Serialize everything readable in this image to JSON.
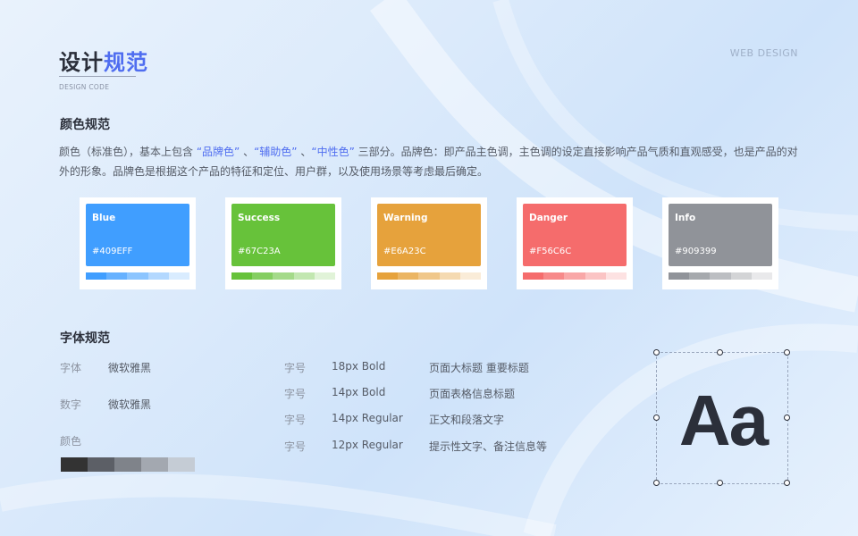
{
  "header": {
    "title_part1": "设计",
    "title_part2": "规范",
    "subtitle": "DESIGN CODE",
    "corner_label": "WEB DESIGN"
  },
  "color_section": {
    "title": "颜色规范",
    "desc_1": "颜色（标准色），基本上包含 ",
    "hl_1": "“品牌色”",
    "sep_1": " 、",
    "hl_2": "“辅助色”",
    "sep_2": " 、",
    "hl_3": "“中性色”",
    "desc_2": " 三部分。品牌色：即产品主色调，主色调的设定直接影响产品气质和直观感受，也是产品的对外的形象。品牌色是根据这个产品的特征和定位、用户群，以及使用场景等考虑最后确定。",
    "cards": [
      {
        "name": "Blue",
        "hex": "#409EFF",
        "color": "#409EFF",
        "tints": [
          "#409EFF",
          "#66b1ff",
          "#8cc5ff",
          "#b3d8ff",
          "#d9ecff"
        ]
      },
      {
        "name": "Success",
        "hex": "#67C23A",
        "color": "#67C23A",
        "tints": [
          "#67C23A",
          "#85ce61",
          "#a4da89",
          "#c2e7b0",
          "#e1f3d8"
        ]
      },
      {
        "name": "Warning",
        "hex": "#E6A23C",
        "color": "#E6A23C",
        "tints": [
          "#E6A23C",
          "#ebb563",
          "#f0c78a",
          "#f5dab1",
          "#faecd8"
        ]
      },
      {
        "name": "Danger",
        "hex": "#F56C6C",
        "color": "#F56C6C",
        "tints": [
          "#F56C6C",
          "#f78989",
          "#f9a7a7",
          "#fbc4c4",
          "#fde2e2"
        ]
      },
      {
        "name": "Info",
        "hex": "#909399",
        "color": "#909399",
        "tints": [
          "#909399",
          "#a6a9ad",
          "#bcbec2",
          "#d3d4d6",
          "#e9e9eb"
        ]
      }
    ]
  },
  "font_section": {
    "title": "字体规范",
    "font_label": "字体",
    "font_value": "微软雅黑",
    "number_label": "数字",
    "number_value": "微软雅黑",
    "color_label": "颜色",
    "gray_scale": [
      "#333333",
      "#5c5f66",
      "#7f838a",
      "#a3a8b0",
      "#c5ccd5"
    ],
    "sizes": [
      {
        "label": "字号",
        "size": "18px Bold",
        "usage": "页面大标题 重要标题"
      },
      {
        "label": "字号",
        "size": "14px Bold",
        "usage": "页面表格信息标题"
      },
      {
        "label": "字号",
        "size": "14px Regular",
        "usage": "正文和段落文字"
      },
      {
        "label": "字号",
        "size": "12px Regular",
        "usage": "提示性文字、备注信息等"
      }
    ],
    "sample_text": "Aa"
  }
}
